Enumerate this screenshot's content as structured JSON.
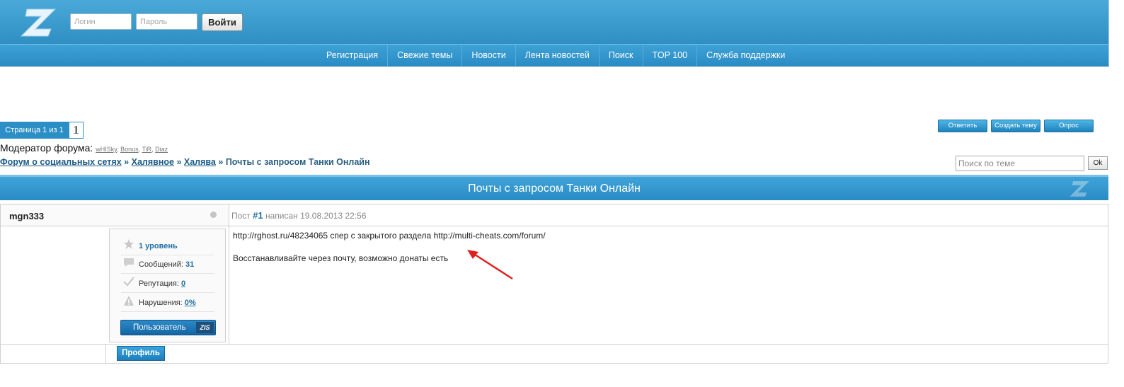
{
  "header": {
    "login_placeholder": "Логин",
    "password_placeholder": "Пароль",
    "login_button": "Войти"
  },
  "nav": {
    "items": [
      "Регистрация",
      "Свежие темы",
      "Новости",
      "Лента новостей",
      "Поиск",
      "TOP 100",
      "Служба поддержки"
    ]
  },
  "pager": {
    "label": "Страница 1 из 1",
    "current": "1"
  },
  "actions": {
    "reply": "Ответить",
    "new_topic": "Создать тему",
    "poll": "Опрос"
  },
  "moderators": {
    "label": "Модератор форума:",
    "names": [
      "wHISky",
      "Bonus",
      "TiR",
      "Diaz"
    ]
  },
  "breadcrumb": {
    "links": [
      "Форум о социальных сетях",
      "Халявное",
      "Халява"
    ],
    "separator": "»",
    "current": "Почты с запросом Танки Онлайн"
  },
  "topic_search": {
    "placeholder": "Поиск по теме",
    "button": "Ok"
  },
  "topic": {
    "title": "Почты с запросом Танки Онлайн"
  },
  "post": {
    "author": "mgn333",
    "meta_prefix": "Пост",
    "number": "#1",
    "meta_suffix": "написан 19.08.2013 22:56",
    "body_line1": "http://rghost.ru/48234065 спер с закрытого раздела http://multi-cheats.com/forum/",
    "body_line2": "Восстанавливайте через почту, возможно донаты есть",
    "profile_button": "Профиль"
  },
  "user_card": {
    "level": "1 уровень",
    "messages_label": "Сообщений:",
    "messages_value": "31",
    "reputation_label": "Репутация:",
    "reputation_value": "0",
    "violations_label": "Нарушения:",
    "violations_value": "0%",
    "role": "Пользователь",
    "role_tag": "ZIS"
  },
  "colors": {
    "header_blue": "#3a9cd0",
    "link": "#1b5a86",
    "arrow_red": "#e02020"
  }
}
